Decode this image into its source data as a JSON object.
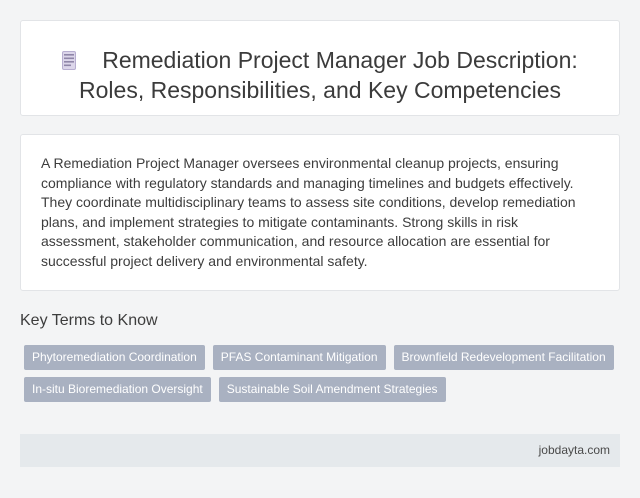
{
  "header": {
    "icon": "document-icon",
    "title_line1": "Remediation Project Manager Job Description:",
    "title_line2": "Roles, Responsibilities, and Key Competencies"
  },
  "description": {
    "text": "A Remediation Project Manager oversees environmental cleanup projects, ensuring compliance with regulatory standards and managing timelines and budgets effectively. They coordinate multidisciplinary teams to assess site conditions, develop remediation plans, and implement strategies to mitigate contaminants. Strong skills in risk assessment, stakeholder communication, and resource allocation are essential for successful project delivery and environmental safety."
  },
  "key_terms": {
    "heading": "Key Terms to Know",
    "tags": [
      "Phytoremediation Coordination",
      "PFAS Contaminant Mitigation",
      "Brownfield Redevelopment Facilitation",
      "In-situ Bioremediation Oversight",
      "Sustainable Soil Amendment Strategies"
    ]
  },
  "footer": {
    "site": "jobdayta.com"
  },
  "colors": {
    "background": "#f3f4f5",
    "card": "#ffffff",
    "tag": "#a9b1c1",
    "footer": "#e5e9ec"
  }
}
